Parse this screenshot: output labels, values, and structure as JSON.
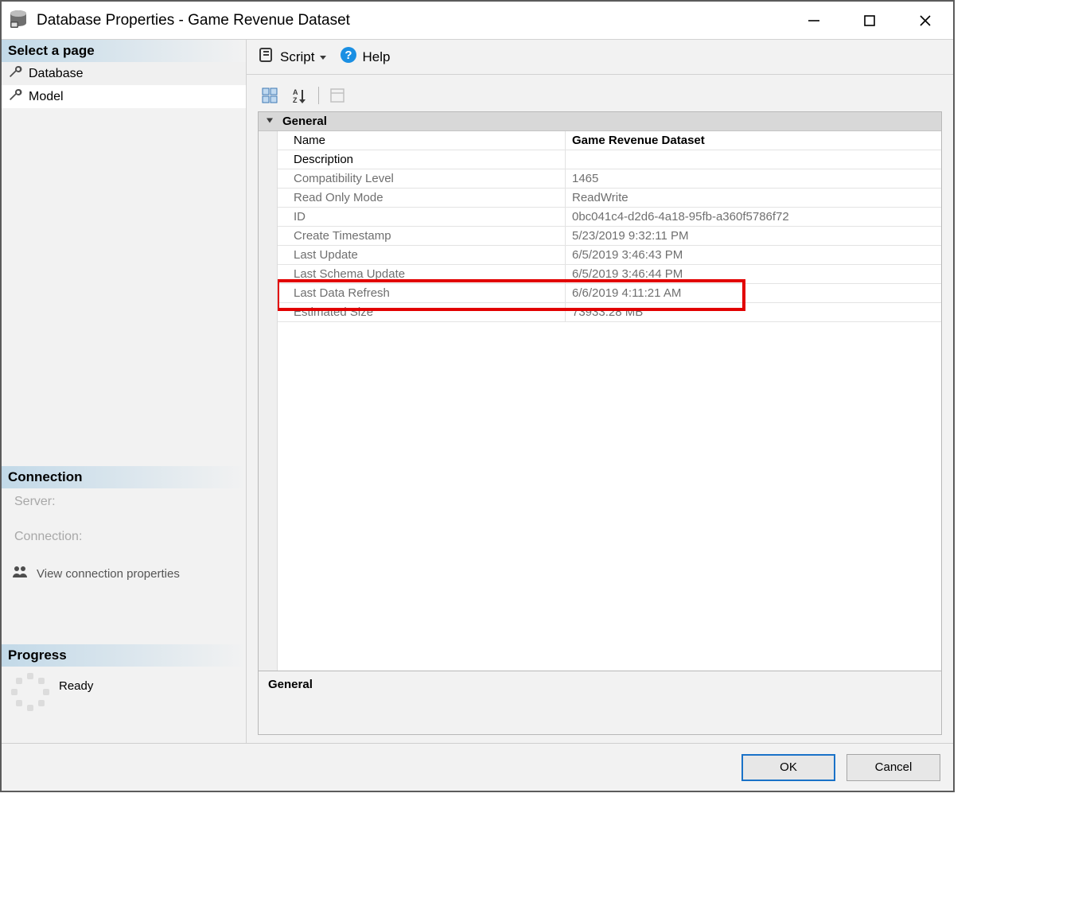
{
  "window": {
    "title": "Database Properties - Game Revenue Dataset"
  },
  "sidebar": {
    "select_header": "Select a page",
    "items": [
      {
        "label": "Database",
        "selected": true
      },
      {
        "label": "Model",
        "selected": false
      }
    ],
    "connection": {
      "header": "Connection",
      "server_label": "Server:",
      "connection_label": "Connection:",
      "view_props": "View connection properties"
    },
    "progress": {
      "header": "Progress",
      "status": "Ready"
    }
  },
  "toolbar": {
    "script_label": "Script",
    "help_label": "Help"
  },
  "grid": {
    "category": "General",
    "rows": [
      {
        "label": "Name",
        "value": "Game Revenue Dataset",
        "mode": "editable",
        "bold": true
      },
      {
        "label": "Description",
        "value": "",
        "mode": "editable"
      },
      {
        "label": "Compatibility Level",
        "value": "1465",
        "mode": "readonly"
      },
      {
        "label": "Read Only Mode",
        "value": "ReadWrite",
        "mode": "readonly"
      },
      {
        "label": "ID",
        "value": "0bc041c4-d2d6-4a18-95fb-a360f5786f72",
        "mode": "readonly"
      },
      {
        "label": "Create Timestamp",
        "value": "5/23/2019 9:32:11 PM",
        "mode": "readonly"
      },
      {
        "label": "Last Update",
        "value": "6/5/2019 3:46:43 PM",
        "mode": "readonly"
      },
      {
        "label": "Last Schema Update",
        "value": "6/5/2019 3:46:44 PM",
        "mode": "readonly"
      },
      {
        "label": "Last Data Refresh",
        "value": "6/6/2019 4:11:21 AM",
        "mode": "readonly"
      },
      {
        "label": "Estimated Size",
        "value": "73933.28 MB",
        "mode": "readonly",
        "highlighted": true
      }
    ],
    "desc_header": "General"
  },
  "footer": {
    "ok": "OK",
    "cancel": "Cancel"
  }
}
